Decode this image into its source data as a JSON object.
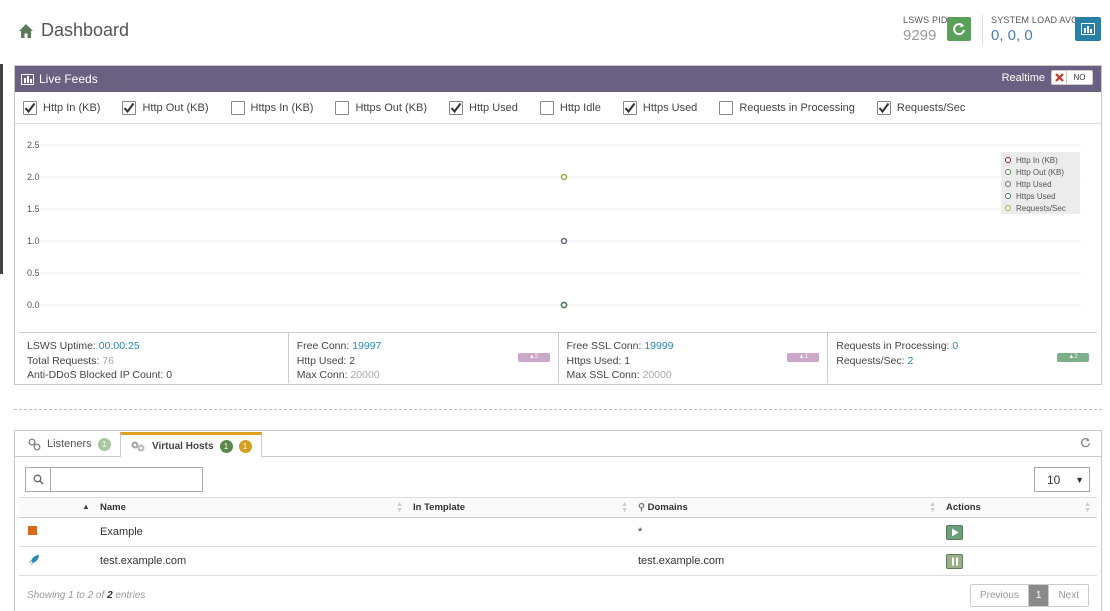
{
  "header": {
    "title": "Dashboard",
    "pid_label": "LSWS PID",
    "pid_value": "9299",
    "load_label": "SYSTEM LOAD AVG",
    "load_value": "0, 0, 0"
  },
  "live_feeds": {
    "title": "Live Feeds",
    "realtime_label": "Realtime",
    "realtime_state": "NO",
    "checks": [
      {
        "label": "Http In (KB)",
        "checked": true
      },
      {
        "label": "Http Out (KB)",
        "checked": true
      },
      {
        "label": "Https In (KB)",
        "checked": false
      },
      {
        "label": "Https Out (KB)",
        "checked": false
      },
      {
        "label": "Http Used",
        "checked": true
      },
      {
        "label": "Http Idle",
        "checked": false
      },
      {
        "label": "Https Used",
        "checked": true
      },
      {
        "label": "Requests in Processing",
        "checked": false
      },
      {
        "label": "Requests/Sec",
        "checked": true
      }
    ]
  },
  "chart_data": {
    "type": "line",
    "title": "",
    "xlabel": "",
    "ylabel": "",
    "ylim": [
      0,
      2.5
    ],
    "yticks": [
      "2.5",
      "2.0",
      "1.5",
      "1.0",
      "0.5",
      "0.0"
    ],
    "grid": true,
    "legend_position": "top-right",
    "series": [
      {
        "name": "Http In (KB)",
        "color": "#8b1a1a",
        "values": [
          0
        ]
      },
      {
        "name": "Http Out (KB)",
        "color": "#5a8a5a",
        "values": [
          0
        ]
      },
      {
        "name": "Http Used",
        "color": "#6a6082",
        "values": [
          1
        ]
      },
      {
        "name": "Https Used",
        "color": "#4a7a5a",
        "values": [
          0
        ]
      },
      {
        "name": "Requests/Sec",
        "color": "#9aaa3a",
        "values": [
          2
        ]
      }
    ]
  },
  "stats": {
    "uptime_label": "LSWS Uptime:",
    "uptime_value": "00:00:25",
    "total_requests_label": "Total Requests:",
    "total_requests_value": "76",
    "antiddos_label": "Anti-DDoS Blocked IP Count:",
    "antiddos_value": "0",
    "free_conn_label": "Free Conn:",
    "free_conn_value": "19997",
    "http_used_label": "Http Used:",
    "http_used_value": "2",
    "max_conn_label": "Max Conn:",
    "max_conn_value": "20000",
    "free_ssl_label": "Free SSL Conn:",
    "free_ssl_value": "19999",
    "https_used_label": "Https Used:",
    "https_used_value": "1",
    "max_ssl_label": "Max SSL Conn:",
    "max_ssl_value": "20000",
    "req_proc_label": "Requests in Processing:",
    "req_proc_value": "0",
    "req_sec_label": "Requests/Sec:",
    "req_sec_value": "2",
    "spark1": "▲2",
    "spark2": "▲1",
    "spark3": "▲2"
  },
  "tabs": {
    "listeners_label": "Listeners",
    "listeners_count": "1",
    "vhosts_label": "Virtual Hosts",
    "vhosts_count_a": "1",
    "vhosts_count_b": "1"
  },
  "table": {
    "page_size": "10",
    "columns": [
      "Name",
      "In Template",
      "Domains",
      "Actions"
    ],
    "rows": [
      {
        "name": "Example",
        "template": "",
        "domains": "*"
      },
      {
        "name": "test.example.com",
        "template": "",
        "domains": "test.example.com"
      }
    ],
    "info_prefix": "Showing 1 to 2 of ",
    "info_total": "2",
    "info_suffix": " entries",
    "prev": "Previous",
    "page": "1",
    "next": "Next"
  },
  "colors": {
    "accent_header": "#6a6082",
    "green_button": "#5aa05a",
    "blue_button": "#2a7fa5",
    "link": "#2a8ab0",
    "tab_active": "#e0a020"
  }
}
